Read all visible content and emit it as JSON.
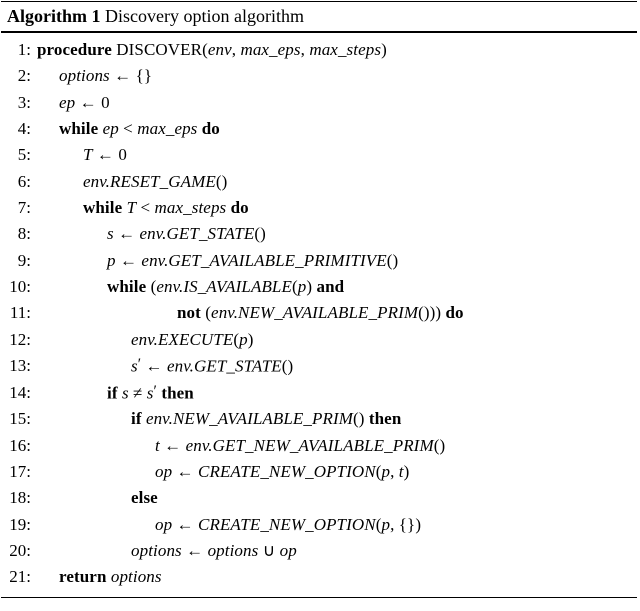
{
  "header": {
    "label": "Algorithm 1",
    "title": "Discovery option algorithm"
  },
  "proc": {
    "kw": "procedure",
    "name": "DISCOVER",
    "args_open": "(",
    "args_close": ")",
    "arg1": "env",
    "arg2": "max_eps",
    "arg3": "max_steps",
    "comma": ", "
  },
  "l2": {
    "lhs": "options",
    "arrow": " ← ",
    "rhs": "{}"
  },
  "l3": {
    "lhs": "ep",
    "arrow": " ← ",
    "rhs": "0"
  },
  "l4": {
    "kw_while": "while ",
    "cond_l": "ep",
    "lt": " < ",
    "cond_r": "max_eps",
    "kw_do": " do"
  },
  "l5": {
    "lhs": "T",
    "arrow": " ← ",
    "rhs": "0"
  },
  "l6": {
    "obj": "env",
    "dot": ".",
    "call": "RESET_GAME",
    "paren": "()"
  },
  "l7": {
    "kw_while": "while ",
    "cond_l": "T",
    "lt": " < ",
    "cond_r": "max_steps",
    "kw_do": " do"
  },
  "l8": {
    "lhs": "s",
    "arrow": " ← ",
    "obj": "env",
    "dot": ".",
    "call": "GET_STATE",
    "paren": "()"
  },
  "l9": {
    "lhs": "p",
    "arrow": " ← ",
    "obj": "env",
    "dot": ".",
    "call": "GET_AVAILABLE_PRIMITIVE",
    "paren": "()"
  },
  "l10": {
    "kw_while": "while ",
    "open": "(",
    "obj": "env",
    "dot": ".",
    "call": "IS_AVAILABLE",
    "popen": "(",
    "arg": "p",
    "pclose": ")",
    "kw_and": " and"
  },
  "l11": {
    "kw_not": "not ",
    "open": "(",
    "obj": "env",
    "dot": ".",
    "call": "NEW_AVAILABLE_PRIM",
    "paren": "()",
    "close": "))",
    "kw_do": " do"
  },
  "l12": {
    "obj": "env",
    "dot": ".",
    "call": "EXECUTE",
    "popen": "(",
    "arg": "p",
    "pclose": ")"
  },
  "l13": {
    "lhs": "s",
    "prime": "′",
    "arrow": " ← ",
    "obj": "env",
    "dot": ".",
    "call": "GET_STATE",
    "paren": "()"
  },
  "l14": {
    "kw_if": "if ",
    "a": "s",
    "ne": " ≠ ",
    "b": "s",
    "prime": "′",
    "kw_then": " then"
  },
  "l15": {
    "kw_if": "if ",
    "obj": "env",
    "dot": ".",
    "call": "NEW_AVAILABLE_PRIM",
    "paren": "()",
    "kw_then": " then"
  },
  "l16": {
    "lhs": "t",
    "arrow": " ← ",
    "obj": "env",
    "dot": ".",
    "call": "GET_NEW_AVAILABLE_PRIM",
    "paren": "()"
  },
  "l17": {
    "lhs": "op",
    "arrow": " ← ",
    "call": "CREATE_NEW_OPTION",
    "popen": "(",
    "a1": "p",
    "comma": ", ",
    "a2": "t",
    "pclose": ")"
  },
  "l18": {
    "kw_else": "else"
  },
  "l19": {
    "lhs": "op",
    "arrow": " ← ",
    "call": "CREATE_NEW_OPTION",
    "popen": "(",
    "a1": "p",
    "comma": ", ",
    "a2": "{}",
    "pclose": ")"
  },
  "l20": {
    "lhs": "options",
    "arrow": " ← ",
    "a": "options",
    "cup": " ∪ ",
    "b": "op"
  },
  "l21": {
    "kw_return": "return ",
    "val": "options"
  },
  "nums": {
    "n1": "1:",
    "n2": "2:",
    "n3": "3:",
    "n4": "4:",
    "n5": "5:",
    "n6": "6:",
    "n7": "7:",
    "n8": "8:",
    "n9": "9:",
    "n10": "10:",
    "n11": "11:",
    "n12": "12:",
    "n13": "13:",
    "n14": "14:",
    "n15": "15:",
    "n16": "16:",
    "n17": "17:",
    "n18": "18:",
    "n19": "19:",
    "n20": "20:",
    "n21": "21:"
  }
}
